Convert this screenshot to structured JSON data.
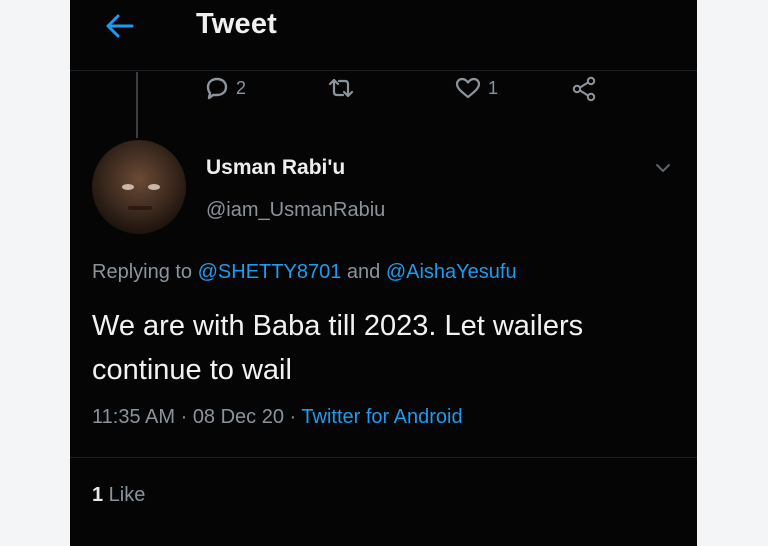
{
  "header": {
    "title": "Tweet",
    "back_icon": "arrow-left-icon"
  },
  "actions": {
    "reply_count": "2",
    "retweet_count": "",
    "like_count": "1",
    "icons": [
      "reply-icon",
      "retweet-icon",
      "heart-icon",
      "share-icon"
    ]
  },
  "tweet": {
    "name": "Usman Rabi'u",
    "handle": "@iam_UsmanRabiu",
    "replying_prefix": "Replying to ",
    "reply_to_1": "@SHETTY8701",
    "reply_and": " and ",
    "reply_to_2": "@AishaYesufu",
    "text": "We are with Baba till 2023. Let wailers continue to wail",
    "time": "11:35 AM",
    "sep1": " · ",
    "date": "08 Dec 20",
    "sep2": " · ",
    "source": "Twitter for Android",
    "likes_count": "1",
    "likes_label": " Like"
  },
  "colors": {
    "background": "#050505",
    "link": "#1d9bf0",
    "muted": "#8b939b",
    "text": "#f2f2f2",
    "page": "#f4f5f7"
  }
}
